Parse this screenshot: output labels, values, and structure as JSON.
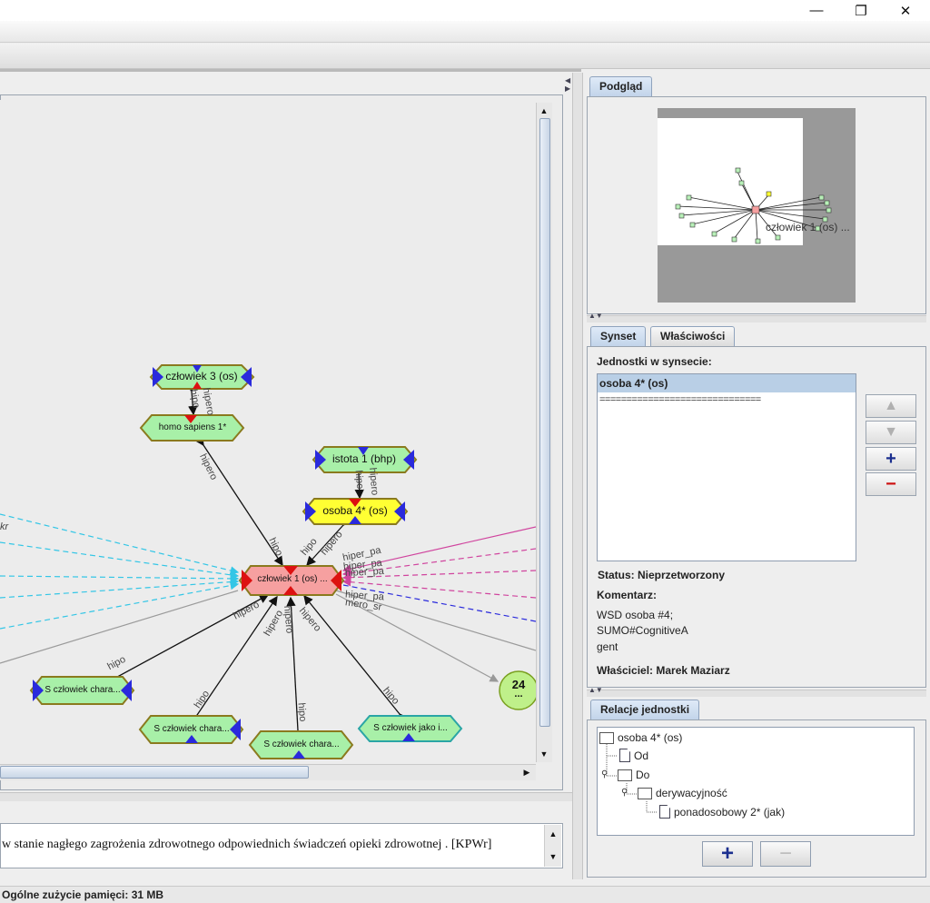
{
  "window": {
    "minimize_glyph": "—",
    "maximize_glyph": "❐",
    "close_glyph": "✕"
  },
  "graph": {
    "nodes": {
      "czlowiek3": "człowiek 3 (os)",
      "homo_sapiens": "homo sapiens 1*",
      "istota": "istota 1 (bhp)",
      "osoba": "osoba 4* (os)",
      "czlowiek1": "człowiek 1 (os) ...",
      "s_chara_left": "S człowiek chara...",
      "s_chara_mid": "S człowiek chara...",
      "s_chara_center": "S człowiek chara...",
      "s_jako": "S człowiek jako i...",
      "badge_count": "24",
      "badge_dots": "..."
    },
    "edge_labels": {
      "hipo_top": "hipo",
      "hipero_top": "hipero",
      "hipero_left": "hipero",
      "hipo_center": "hipo",
      "hipo_osoba": "hipo",
      "hipero_osoba": "hipero",
      "hiper_pa_1": "hiper_pa",
      "hiper_pa_2": "hiper_pa",
      "hiper_pa_3": "hiper_pa",
      "hiper_pa_4": "hiper_pa",
      "mero_sr": "mero_sr",
      "kr": "kr",
      "hipero_b1": "hipero",
      "hipero_b2": "hipero",
      "hipero_b3": "hipero",
      "hipero_b4": "hipero",
      "hipo_b1": "hipo",
      "hipo_b2": "hipo",
      "hipo_b3": "hipo",
      "hipo_b4": "hipo",
      "hipo_istota": "hipo",
      "hipero_istota": "hipero"
    }
  },
  "bottom_text": "w stanie nagłego zagrożenia zdrowotnego odpowiednich świadczeń opieki zdrowotnej . [KPWr]",
  "status_bar": "Ogólne zużycie pamięci: 31 MB",
  "preview": {
    "tab_label": "Podgląd",
    "node_label": "człowiek 1 (os) ..."
  },
  "synset_panel": {
    "tabs": [
      "Synset",
      "Właściwości"
    ],
    "units_label": "Jednostki w synsecie:",
    "units": [
      "osoba 4* (os)"
    ],
    "separator": "==============================",
    "status": "Status: Nieprzetworzony",
    "comment_label": "Komentarz:",
    "comment_lines": [
      "WSD osoba #4;",
      "SUMO#CognitiveA",
      "gent"
    ],
    "owner": "Właściciel: Marek Maziarz",
    "up_glyph": "▲",
    "down_glyph": "▼",
    "add_glyph": "+",
    "remove_glyph": "−"
  },
  "relations_panel": {
    "tab_label": "Relacje jednostki",
    "tree": {
      "root": "osoba 4* (os)",
      "od": "Od",
      "do": "Do",
      "derywacyjnosc": "derywacyjność",
      "ponadosobowy": "ponadosobowy 2* (jak)"
    },
    "add_glyph": "+",
    "remove_glyph": "−"
  },
  "colors": {
    "node_green": "#a8f0a8",
    "node_yellow": "#ffff33",
    "node_red": "#f6a0a0",
    "node_border": "#8a7a1e",
    "arrow_blue": "#2a2adc",
    "marker_red": "#dd1111",
    "edge_cyan": "#33c6e6",
    "edge_magenta": "#d0449e",
    "edge_blue": "#2a2adc",
    "edge_gray": "#9a9a9a"
  }
}
